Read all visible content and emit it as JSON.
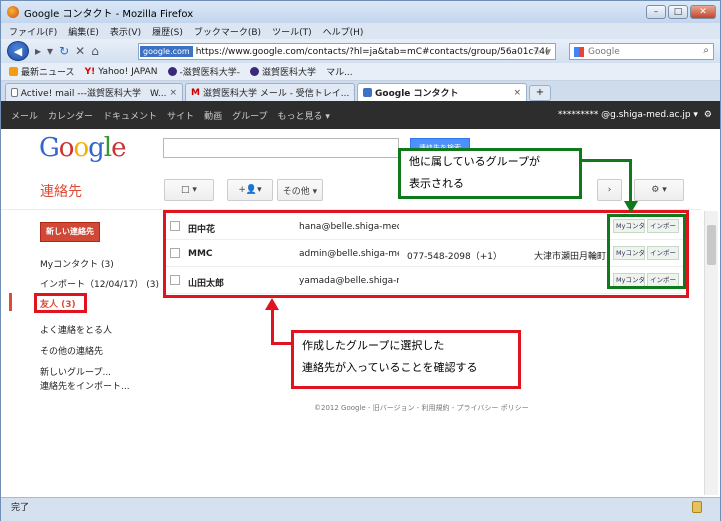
{
  "window": {
    "title": "Google コンタクト - Mozilla Firefox"
  },
  "menubar": [
    "ファイル(F)",
    "編集(E)",
    "表示(V)",
    "履歴(S)",
    "ブックマーク(B)",
    "ツール(T)",
    "ヘルプ(H)"
  ],
  "url": {
    "site": "google.com",
    "value": "https://www.google.com/contacts/?hl=ja&tab=mC#contacts/group/56a01c74("
  },
  "search_placeholder": "Google",
  "bookmarks": [
    "最新ニュース",
    "Yahoo! JAPAN",
    "-滋賀医科大学-",
    "滋賀医科大学",
    "マル..."
  ],
  "tabs": [
    {
      "label": "Active! mail ---滋賀医科大学　W..."
    },
    {
      "label": "滋賀医科大学 メール - 受信トレイ..."
    },
    {
      "label": "Google コンタクト"
    }
  ],
  "gbar": {
    "links": [
      "メール",
      "カレンダー",
      "ドキュメント",
      "サイト",
      "動画",
      "グループ",
      "もっと見る ▾"
    ],
    "account": "********* @g.shiga-med.ac.jp ▾"
  },
  "logo": {
    "g1": "G",
    "o1": "o",
    "o2": "o",
    "g2": "g",
    "l": "l",
    "e": "e"
  },
  "search_button": "連絡先を検索",
  "heading": "連絡先",
  "toolbar": {
    "select": "□ ▾",
    "add": "+👤▾",
    "more": "その他 ▾",
    "gear": "⚙ ▾"
  },
  "new_contact": "新しい連絡先",
  "sidebar": {
    "mycontacts": "Myコンタクト (3)",
    "import": "インポート（12/04/17） (3)",
    "friends": "友人 (3)",
    "frequent": "よく連絡をとる人",
    "other": "その他の連絡先",
    "new_group": "新しいグループ...",
    "import_contacts": "連絡先をインポート..."
  },
  "contacts": [
    {
      "name": "田中花",
      "email": "hana@belle.shiga-med.ac.jp",
      "phone": "",
      "address": "",
      "labels": [
        "Myコンタクト",
        "インポート"
      ]
    },
    {
      "name": "MMC",
      "email": "admin@belle.shiga-med.ac.jp",
      "phone": "077-548-2098（+1）",
      "address": "大津市瀬田月輪町",
      "labels": [
        "Myコンタクト",
        "インポート"
      ]
    },
    {
      "name": "山田太郎",
      "email": "yamada@belle.shiga-med.ac.jp",
      "phone": "",
      "address": "",
      "labels": [
        "Myコンタクト",
        "インポート"
      ]
    }
  ],
  "footer": "©2012 Google - 旧バージョン - 利用規約 - プライバシー ポリシー",
  "annotations": {
    "top_right": [
      "他に属しているグループが",
      "表示される"
    ],
    "bottom": [
      "作成したグループに選択した",
      "連絡先が入っていることを確認する"
    ]
  },
  "status": "完了",
  "colors": {
    "accent_red": "#e0131f",
    "accent_green": "#0e7a1c",
    "google_red": "#dd4b39"
  }
}
